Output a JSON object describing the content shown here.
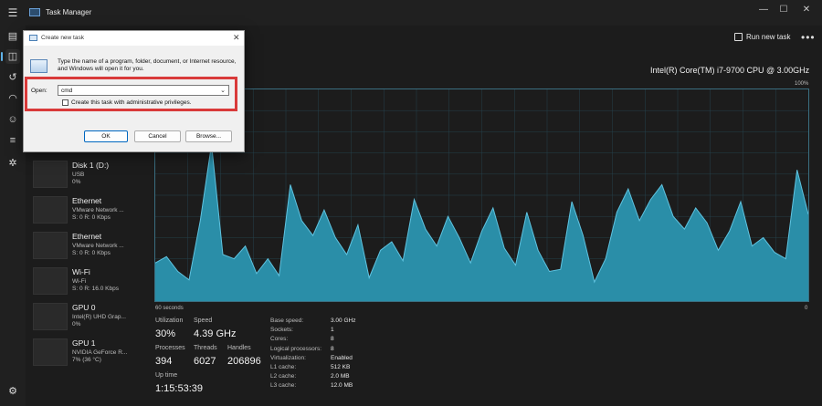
{
  "window": {
    "title": "Task Manager"
  },
  "toolbar": {
    "run_new_task": "Run new task"
  },
  "cpu": {
    "model": "Intel(R) Core(TM) i7-9700 CPU @ 3.00GHz",
    "axis_top": "100%",
    "axis_left": "60 seconds",
    "axis_right": "0",
    "series": [
      18,
      21,
      14,
      10,
      38,
      74,
      22,
      20,
      26,
      13,
      20,
      12,
      55,
      38,
      31,
      43,
      30,
      22,
      36,
      11,
      24,
      28,
      19,
      48,
      34,
      26,
      40,
      30,
      18,
      33,
      44,
      25,
      17,
      42,
      24,
      14,
      15,
      47,
      31,
      9,
      20,
      42,
      53,
      38,
      48,
      55,
      40,
      34,
      44,
      37,
      24,
      33,
      47,
      26,
      30,
      23,
      20,
      62,
      41
    ],
    "line_color": "#5fc3e0",
    "fill_color": "#2a8ea8"
  },
  "stats": {
    "utilization": {
      "label": "Utilization",
      "value": "30%"
    },
    "speed": {
      "label": "Speed",
      "value": "4.39 GHz"
    },
    "processes": {
      "label": "Processes",
      "value": "394"
    },
    "threads": {
      "label": "Threads",
      "value": "6027"
    },
    "handles": {
      "label": "Handles",
      "value": "206896"
    },
    "uptime": {
      "label": "Up time",
      "value": "1:15:53:39"
    }
  },
  "details": [
    {
      "label": "Base speed:",
      "value": "3.00 GHz"
    },
    {
      "label": "Sockets:",
      "value": "1"
    },
    {
      "label": "Cores:",
      "value": "8"
    },
    {
      "label": "Logical processors:",
      "value": "8"
    },
    {
      "label": "Virtualization:",
      "value": "Enabled"
    },
    {
      "label": "L1 cache:",
      "value": "512 KB"
    },
    {
      "label": "L2 cache:",
      "value": "2.0 MB"
    },
    {
      "label": "L3 cache:",
      "value": "12.0 MB"
    }
  ],
  "devices": [
    {
      "name": "Disk 1 (D:)",
      "sub1": "USB",
      "sub2": "0%"
    },
    {
      "name": "Ethernet",
      "sub1": "VMware Network ...",
      "sub2": "S: 0 R: 0 Kbps"
    },
    {
      "name": "Ethernet",
      "sub1": "VMware Network ...",
      "sub2": "S: 0 R: 0 Kbps"
    },
    {
      "name": "Wi-Fi",
      "sub1": "Wi-Fi",
      "sub2": "S: 0 R: 16.0 Kbps"
    },
    {
      "name": "GPU 0",
      "sub1": "Intel(R) UHD Grap...",
      "sub2": "0%"
    },
    {
      "name": "GPU 1",
      "sub1": "NVIDIA GeForce R...",
      "sub2": "7% (36 °C)"
    }
  ],
  "dialog": {
    "title": "Create new task",
    "description": "Type the name of a program, folder, document, or Internet resource, and Windows will open it for you.",
    "open_label": "Open:",
    "open_value": "cmd",
    "checkbox_label": "Create this task with administrative privileges.",
    "ok": "OK",
    "cancel": "Cancel",
    "browse": "Browse..."
  }
}
